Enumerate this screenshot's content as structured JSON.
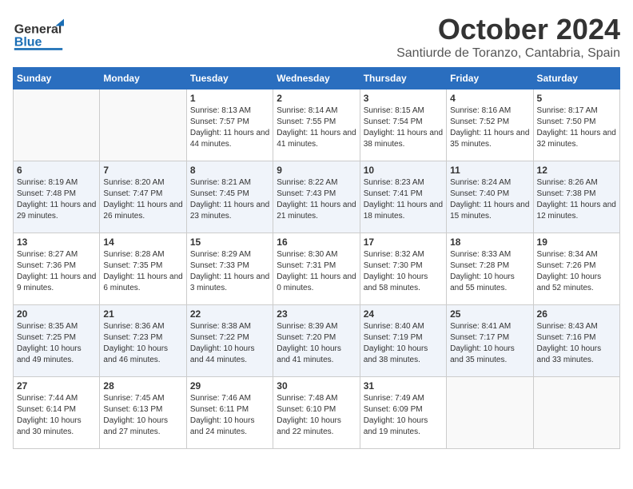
{
  "header": {
    "logo_general": "General",
    "logo_blue": "Blue",
    "month_title": "October 2024",
    "location": "Santiurde de Toranzo, Cantabria, Spain"
  },
  "weekdays": [
    "Sunday",
    "Monday",
    "Tuesday",
    "Wednesday",
    "Thursday",
    "Friday",
    "Saturday"
  ],
  "weeks": [
    [
      {
        "day": "",
        "info": ""
      },
      {
        "day": "",
        "info": ""
      },
      {
        "day": "1",
        "info": "Sunrise: 8:13 AM\nSunset: 7:57 PM\nDaylight: 11 hours and 44 minutes."
      },
      {
        "day": "2",
        "info": "Sunrise: 8:14 AM\nSunset: 7:55 PM\nDaylight: 11 hours and 41 minutes."
      },
      {
        "day": "3",
        "info": "Sunrise: 8:15 AM\nSunset: 7:54 PM\nDaylight: 11 hours and 38 minutes."
      },
      {
        "day": "4",
        "info": "Sunrise: 8:16 AM\nSunset: 7:52 PM\nDaylight: 11 hours and 35 minutes."
      },
      {
        "day": "5",
        "info": "Sunrise: 8:17 AM\nSunset: 7:50 PM\nDaylight: 11 hours and 32 minutes."
      }
    ],
    [
      {
        "day": "6",
        "info": "Sunrise: 8:19 AM\nSunset: 7:48 PM\nDaylight: 11 hours and 29 minutes."
      },
      {
        "day": "7",
        "info": "Sunrise: 8:20 AM\nSunset: 7:47 PM\nDaylight: 11 hours and 26 minutes."
      },
      {
        "day": "8",
        "info": "Sunrise: 8:21 AM\nSunset: 7:45 PM\nDaylight: 11 hours and 23 minutes."
      },
      {
        "day": "9",
        "info": "Sunrise: 8:22 AM\nSunset: 7:43 PM\nDaylight: 11 hours and 21 minutes."
      },
      {
        "day": "10",
        "info": "Sunrise: 8:23 AM\nSunset: 7:41 PM\nDaylight: 11 hours and 18 minutes."
      },
      {
        "day": "11",
        "info": "Sunrise: 8:24 AM\nSunset: 7:40 PM\nDaylight: 11 hours and 15 minutes."
      },
      {
        "day": "12",
        "info": "Sunrise: 8:26 AM\nSunset: 7:38 PM\nDaylight: 11 hours and 12 minutes."
      }
    ],
    [
      {
        "day": "13",
        "info": "Sunrise: 8:27 AM\nSunset: 7:36 PM\nDaylight: 11 hours and 9 minutes."
      },
      {
        "day": "14",
        "info": "Sunrise: 8:28 AM\nSunset: 7:35 PM\nDaylight: 11 hours and 6 minutes."
      },
      {
        "day": "15",
        "info": "Sunrise: 8:29 AM\nSunset: 7:33 PM\nDaylight: 11 hours and 3 minutes."
      },
      {
        "day": "16",
        "info": "Sunrise: 8:30 AM\nSunset: 7:31 PM\nDaylight: 11 hours and 0 minutes."
      },
      {
        "day": "17",
        "info": "Sunrise: 8:32 AM\nSunset: 7:30 PM\nDaylight: 10 hours and 58 minutes."
      },
      {
        "day": "18",
        "info": "Sunrise: 8:33 AM\nSunset: 7:28 PM\nDaylight: 10 hours and 55 minutes."
      },
      {
        "day": "19",
        "info": "Sunrise: 8:34 AM\nSunset: 7:26 PM\nDaylight: 10 hours and 52 minutes."
      }
    ],
    [
      {
        "day": "20",
        "info": "Sunrise: 8:35 AM\nSunset: 7:25 PM\nDaylight: 10 hours and 49 minutes."
      },
      {
        "day": "21",
        "info": "Sunrise: 8:36 AM\nSunset: 7:23 PM\nDaylight: 10 hours and 46 minutes."
      },
      {
        "day": "22",
        "info": "Sunrise: 8:38 AM\nSunset: 7:22 PM\nDaylight: 10 hours and 44 minutes."
      },
      {
        "day": "23",
        "info": "Sunrise: 8:39 AM\nSunset: 7:20 PM\nDaylight: 10 hours and 41 minutes."
      },
      {
        "day": "24",
        "info": "Sunrise: 8:40 AM\nSunset: 7:19 PM\nDaylight: 10 hours and 38 minutes."
      },
      {
        "day": "25",
        "info": "Sunrise: 8:41 AM\nSunset: 7:17 PM\nDaylight: 10 hours and 35 minutes."
      },
      {
        "day": "26",
        "info": "Sunrise: 8:43 AM\nSunset: 7:16 PM\nDaylight: 10 hours and 33 minutes."
      }
    ],
    [
      {
        "day": "27",
        "info": "Sunrise: 7:44 AM\nSunset: 6:14 PM\nDaylight: 10 hours and 30 minutes."
      },
      {
        "day": "28",
        "info": "Sunrise: 7:45 AM\nSunset: 6:13 PM\nDaylight: 10 hours and 27 minutes."
      },
      {
        "day": "29",
        "info": "Sunrise: 7:46 AM\nSunset: 6:11 PM\nDaylight: 10 hours and 24 minutes."
      },
      {
        "day": "30",
        "info": "Sunrise: 7:48 AM\nSunset: 6:10 PM\nDaylight: 10 hours and 22 minutes."
      },
      {
        "day": "31",
        "info": "Sunrise: 7:49 AM\nSunset: 6:09 PM\nDaylight: 10 hours and 19 minutes."
      },
      {
        "day": "",
        "info": ""
      },
      {
        "day": "",
        "info": ""
      }
    ]
  ]
}
